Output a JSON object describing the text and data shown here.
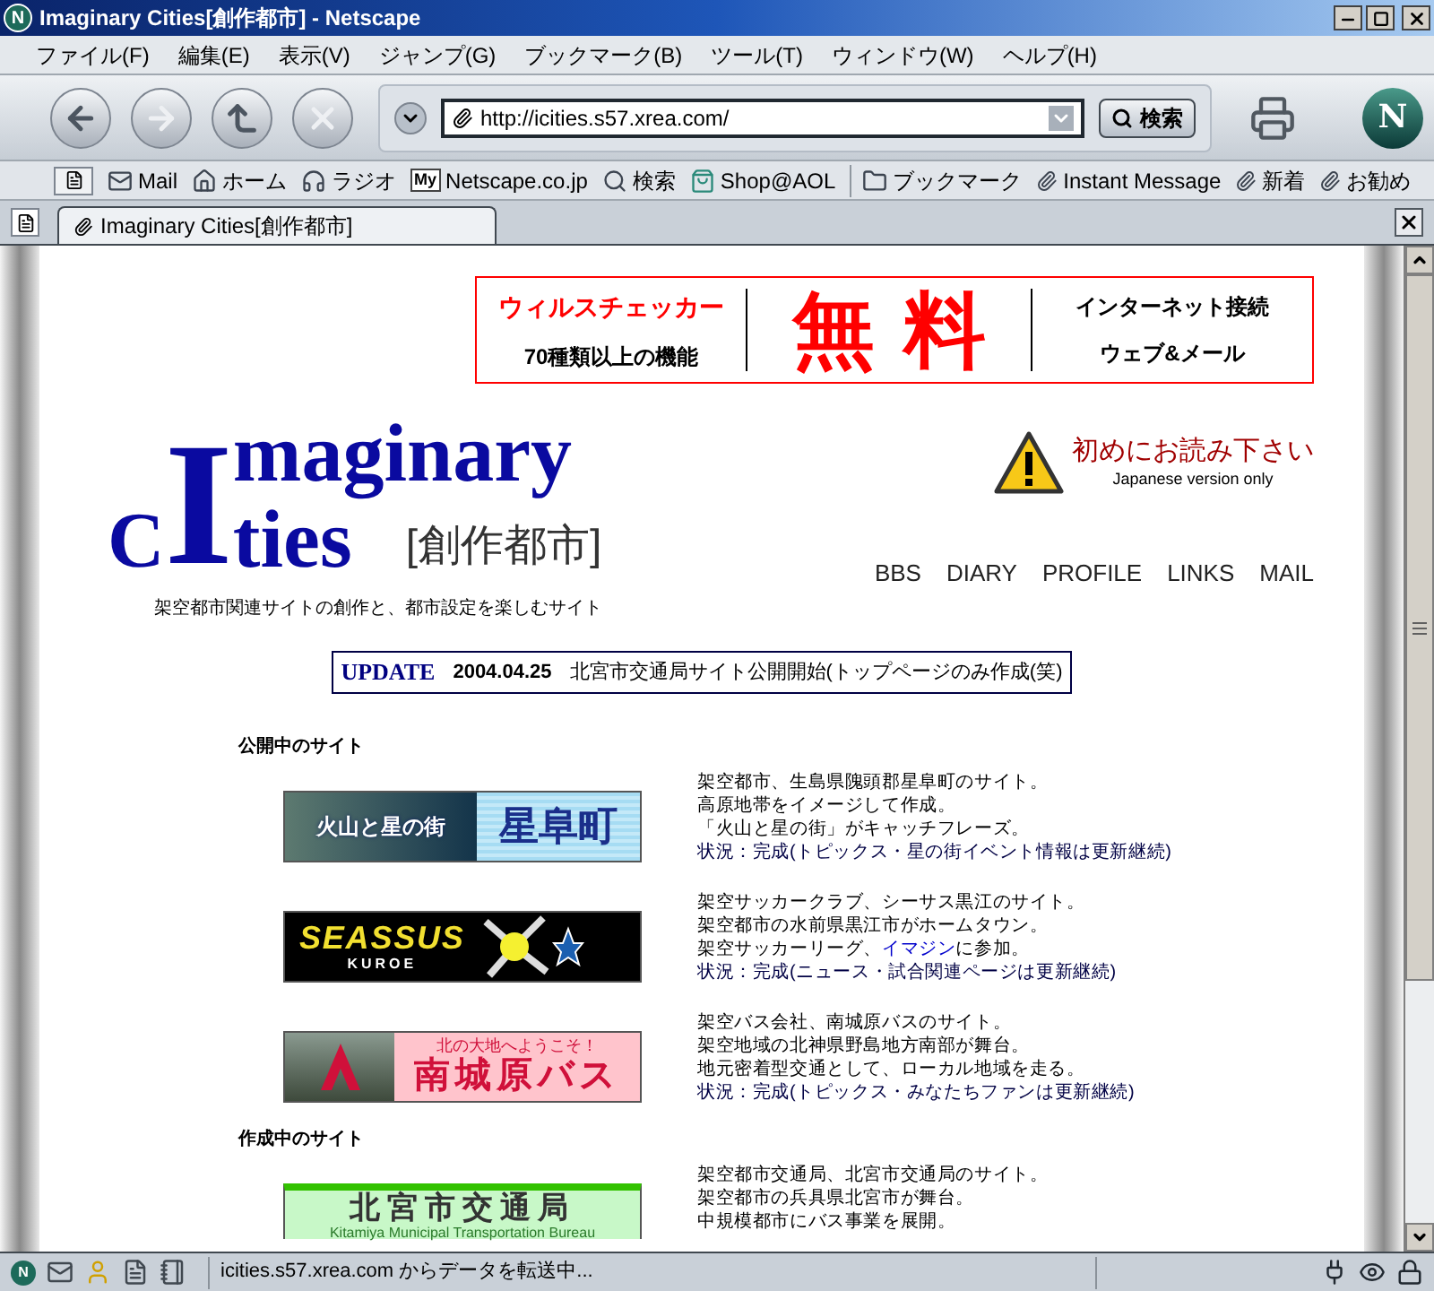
{
  "window": {
    "icon": "N",
    "title": "Imaginary Cities[創作都市] - Netscape"
  },
  "toolbar_logo": "N",
  "menu": [
    "ファイル(F)",
    "編集(E)",
    "表示(V)",
    "ジャンプ(G)",
    "ブックマーク(B)",
    "ツール(T)",
    "ウィンドウ(W)",
    "ヘルプ(H)"
  ],
  "address": {
    "value": "http://icities.s57.xrea.com/"
  },
  "search_button": "検索",
  "personal_toolbar": [
    {
      "kind": "mail",
      "label": "Mail"
    },
    {
      "kind": "home",
      "label": "ホーム"
    },
    {
      "kind": "radio",
      "label": "ラジオ"
    },
    {
      "kind": "my",
      "label": "Netscape.co.jp",
      "badge": "My"
    },
    {
      "kind": "search",
      "label": "検索"
    },
    {
      "kind": "shop",
      "label": "Shop@AOL"
    },
    {
      "kind": "folder",
      "label": "ブックマーク"
    },
    {
      "kind": "bookmark",
      "label": "Instant Message"
    },
    {
      "kind": "bookmark",
      "label": "新着"
    },
    {
      "kind": "bookmark",
      "label": "お勧め"
    }
  ],
  "tabs": [
    {
      "label": "Imaginary Cities[創作都市]",
      "selected": true
    }
  ],
  "ad": {
    "left_top": "ウィルスチェッカー",
    "left_bottom": "70種類以上の機能",
    "center": "無 料",
    "right_top": "インターネット接続",
    "right_bottom": "ウェブ&メール"
  },
  "logo": {
    "initial": "I",
    "line1": "maginary",
    "line2_before": "C",
    "line2_after": "ties",
    "subtitle": "[創作都市]",
    "tagline": "架空都市関連サイトの創作と、都市設定を楽しむサイト"
  },
  "notice": {
    "title": "初めにお読み下さい",
    "subtitle": "Japanese version only"
  },
  "nav_links": [
    "BBS",
    "DIARY",
    "PROFILE",
    "LINKS",
    "MAIL"
  ],
  "update": {
    "label": "UPDATE",
    "date": "2004.04.25",
    "text": "北宮市交通局サイト公開開始(トップページのみ作成(笑)"
  },
  "sections": [
    {
      "heading": "公開中のサイト",
      "sites": [
        {
          "banner": {
            "kind": "star",
            "left": "火山と星の街",
            "right": "星阜町"
          },
          "lines": [
            {
              "kind": "plain",
              "text": "架空都市、生島県隗頭郡星阜町のサイト。"
            },
            {
              "kind": "plain",
              "text": "高原地帯をイメージして作成。"
            },
            {
              "kind": "plain",
              "text": "「火山と星の街」がキャッチフレーズ。"
            },
            {
              "kind": "status",
              "text": "状況：完成(トピックス・星の街イベント情報は更新継続)"
            }
          ]
        },
        {
          "banner": {
            "kind": "soccer",
            "left": "SEASSUS",
            "right": "KUROE"
          },
          "lines": [
            {
              "kind": "plain",
              "text": "架空サッカークラブ、シーサス黒江のサイト。"
            },
            {
              "kind": "plain",
              "text": "架空都市の水前県黒江市がホームタウン。"
            },
            {
              "kind": "link",
              "before": "架空サッカーリーグ、",
              "link": "イマジン",
              "after": "に参加。"
            },
            {
              "kind": "status",
              "text": "状況：完成(ニュース・試合関連ページは更新継続)"
            }
          ]
        },
        {
          "banner": {
            "kind": "bus",
            "left": "北の大地へようこそ！",
            "right": "南城原バス"
          },
          "lines": [
            {
              "kind": "plain",
              "text": "架空バス会社、南城原バスのサイト。"
            },
            {
              "kind": "plain",
              "text": "架空地域の北神県野島地方南部が舞台。"
            },
            {
              "kind": "plain",
              "text": "地元密着型交通として、ローカル地域を走る。"
            },
            {
              "kind": "status",
              "text": "状況：完成(トピックス・みなたちファンは更新継続)"
            }
          ]
        }
      ]
    },
    {
      "heading": "作成中のサイト",
      "sites": [
        {
          "banner": {
            "kind": "transit",
            "left": "北宮市交通局",
            "right": "Kitamiya Municipal Transportation Bureau"
          },
          "lines": [
            {
              "kind": "plain",
              "text": "架空都市交通局、北宮市交通局のサイト。"
            },
            {
              "kind": "plain",
              "text": "架空都市の兵具県北宮市が舞台。"
            },
            {
              "kind": "plain",
              "text": "中規模都市にバス事業を展開。"
            }
          ]
        }
      ]
    }
  ],
  "status_bar": {
    "icon": "N",
    "text": "icities.s57.xrea.com からデータを転送中..."
  }
}
